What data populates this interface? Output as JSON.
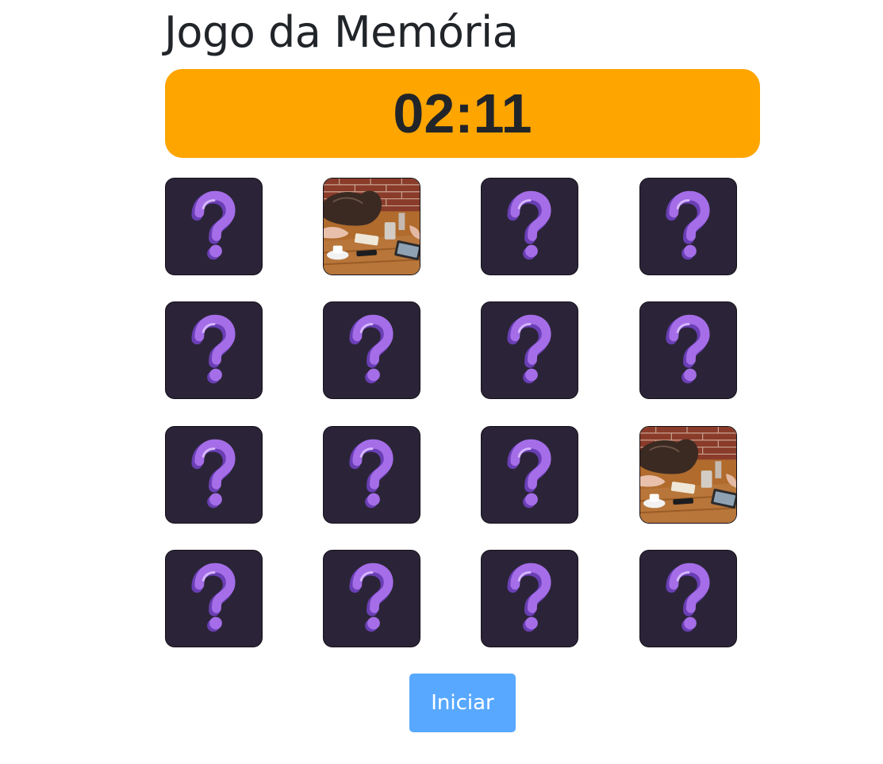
{
  "title": "Jogo da Memória",
  "timer": {
    "value": "02:11",
    "background_color": "#ffa500"
  },
  "board": {
    "rows": 4,
    "columns": 4,
    "cards": [
      {
        "state": "hidden",
        "icon": "question-mark-icon"
      },
      {
        "state": "revealed",
        "image": "cafe-table-photo"
      },
      {
        "state": "hidden",
        "icon": "question-mark-icon"
      },
      {
        "state": "hidden",
        "icon": "question-mark-icon"
      },
      {
        "state": "hidden",
        "icon": "question-mark-icon"
      },
      {
        "state": "hidden",
        "icon": "question-mark-icon"
      },
      {
        "state": "hidden",
        "icon": "question-mark-icon"
      },
      {
        "state": "hidden",
        "icon": "question-mark-icon"
      },
      {
        "state": "hidden",
        "icon": "question-mark-icon"
      },
      {
        "state": "hidden",
        "icon": "question-mark-icon"
      },
      {
        "state": "hidden",
        "icon": "question-mark-icon"
      },
      {
        "state": "revealed",
        "image": "cafe-table-photo"
      },
      {
        "state": "hidden",
        "icon": "question-mark-icon"
      },
      {
        "state": "hidden",
        "icon": "question-mark-icon"
      },
      {
        "state": "hidden",
        "icon": "question-mark-icon"
      },
      {
        "state": "hidden",
        "icon": "question-mark-icon"
      }
    ],
    "card_back_color": "#2b2438",
    "question_mark_color": "#a56ee8"
  },
  "start_button": {
    "label": "Iniciar",
    "color": "#58a8ff"
  }
}
